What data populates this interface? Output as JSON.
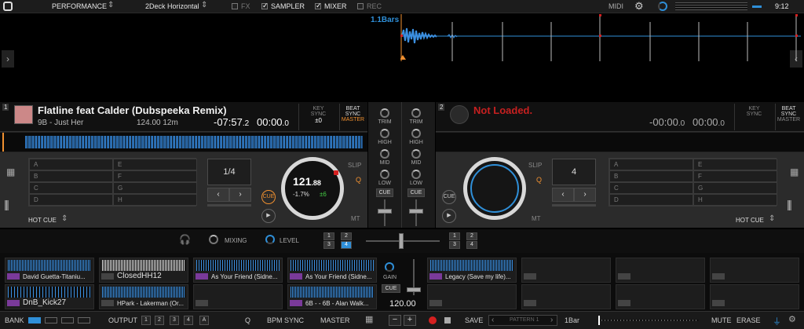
{
  "topbar": {
    "mode": "PERFORMANCE",
    "layout": "2Deck Horizontal",
    "fx": "FX",
    "sampler": "SAMPLER",
    "mixer": "MIXER",
    "rec": "REC",
    "midi": "MIDI",
    "clock": "9:12"
  },
  "overview": {
    "bars_label": "1.1Bars"
  },
  "deck1": {
    "number": "1",
    "title": "Flatline feat Calder (Dubspeeka Remix)",
    "key_artist": "9B - Just Her",
    "bpm_len": "124.00 12m",
    "remain": "-07:57",
    "remain_frac": ".2",
    "elapsed": "00:00",
    "elapsed_frac": ".0",
    "key_label": "KEY",
    "sync_label": "SYNC",
    "key_value": "±0",
    "beat_label": "BEAT",
    "beat_sync": "SYNC",
    "master": "MASTER",
    "hotcues": [
      "A",
      "E",
      "B",
      "F",
      "C",
      "G",
      "D",
      "H"
    ],
    "loop": "1/4",
    "jog_bpm": "121",
    "jog_bpm_frac": ".88",
    "jog_pitch": "-1.7%",
    "jog_range": "±6",
    "slip": "SLIP",
    "q": "Q",
    "mt": "MT",
    "cue": "CUE",
    "hotcue_mode": "HOT CUE"
  },
  "deck2": {
    "number": "2",
    "title": "Not Loaded.",
    "remain": "-00:00",
    "remain_frac": ".0",
    "elapsed": "00:00",
    "elapsed_frac": ".0",
    "key_label": "KEY",
    "sync_label": "SYNC",
    "beat_label": "BEAT",
    "beat_sync": "SYNC",
    "master": "MASTER",
    "hotcues": [
      "A",
      "E",
      "B",
      "F",
      "C",
      "G",
      "D",
      "H"
    ],
    "loop": "4",
    "slip": "SLIP",
    "q": "Q",
    "mt": "MT",
    "cue": "CUE",
    "hotcue_mode": "HOT CUE"
  },
  "mixer": {
    "trim": "TRIM",
    "high": "HIGH",
    "mid": "MID",
    "low": "LOW",
    "cue": "CUE"
  },
  "fxrow": {
    "mixing": "MIXING",
    "level": "LEVEL",
    "left_nums": [
      "1",
      "2",
      "3",
      "4"
    ],
    "right_nums": [
      "1",
      "2",
      "3",
      "4"
    ]
  },
  "sampler": {
    "slots": [
      {
        "name": "David Guetta-Titaniu...",
        "tag": true,
        "big": false
      },
      {
        "name": "ClosedHH12",
        "tag": false,
        "big": true
      },
      {
        "name": "As Your Friend (Sidne...",
        "tag": true,
        "big": false
      },
      {
        "name": "As Your Friend (Sidne...",
        "tag": true,
        "big": false
      },
      {
        "name": "DnB_Kick27",
        "tag": true,
        "big": true
      },
      {
        "name": "HPark - Lakerman (Or...",
        "tag": false,
        "big": false
      },
      {
        "name": "",
        "tag": false,
        "big": false
      },
      {
        "name": "6B - - 6B - Alan Walk...",
        "tag": true,
        "big": false
      },
      {
        "name": "Legacy (Save my life)...",
        "tag": true,
        "big": false
      }
    ],
    "gain": "GAIN",
    "cue": "CUE",
    "bpm": "120.00"
  },
  "bottombar": {
    "bank": "BANK",
    "output": "OUTPUT",
    "outputs": [
      "1",
      "2",
      "3",
      "4",
      "A"
    ],
    "q": "Q",
    "bpm_sync": "BPM SYNC",
    "master": "MASTER",
    "save": "SAVE",
    "pattern": "PATTERN 1",
    "bar": "1Bar",
    "mute": "MUTE",
    "erase": "ERASE"
  },
  "colors": {
    "accent": "#2f8fd8",
    "orange": "#f09030",
    "red": "#d52020"
  }
}
